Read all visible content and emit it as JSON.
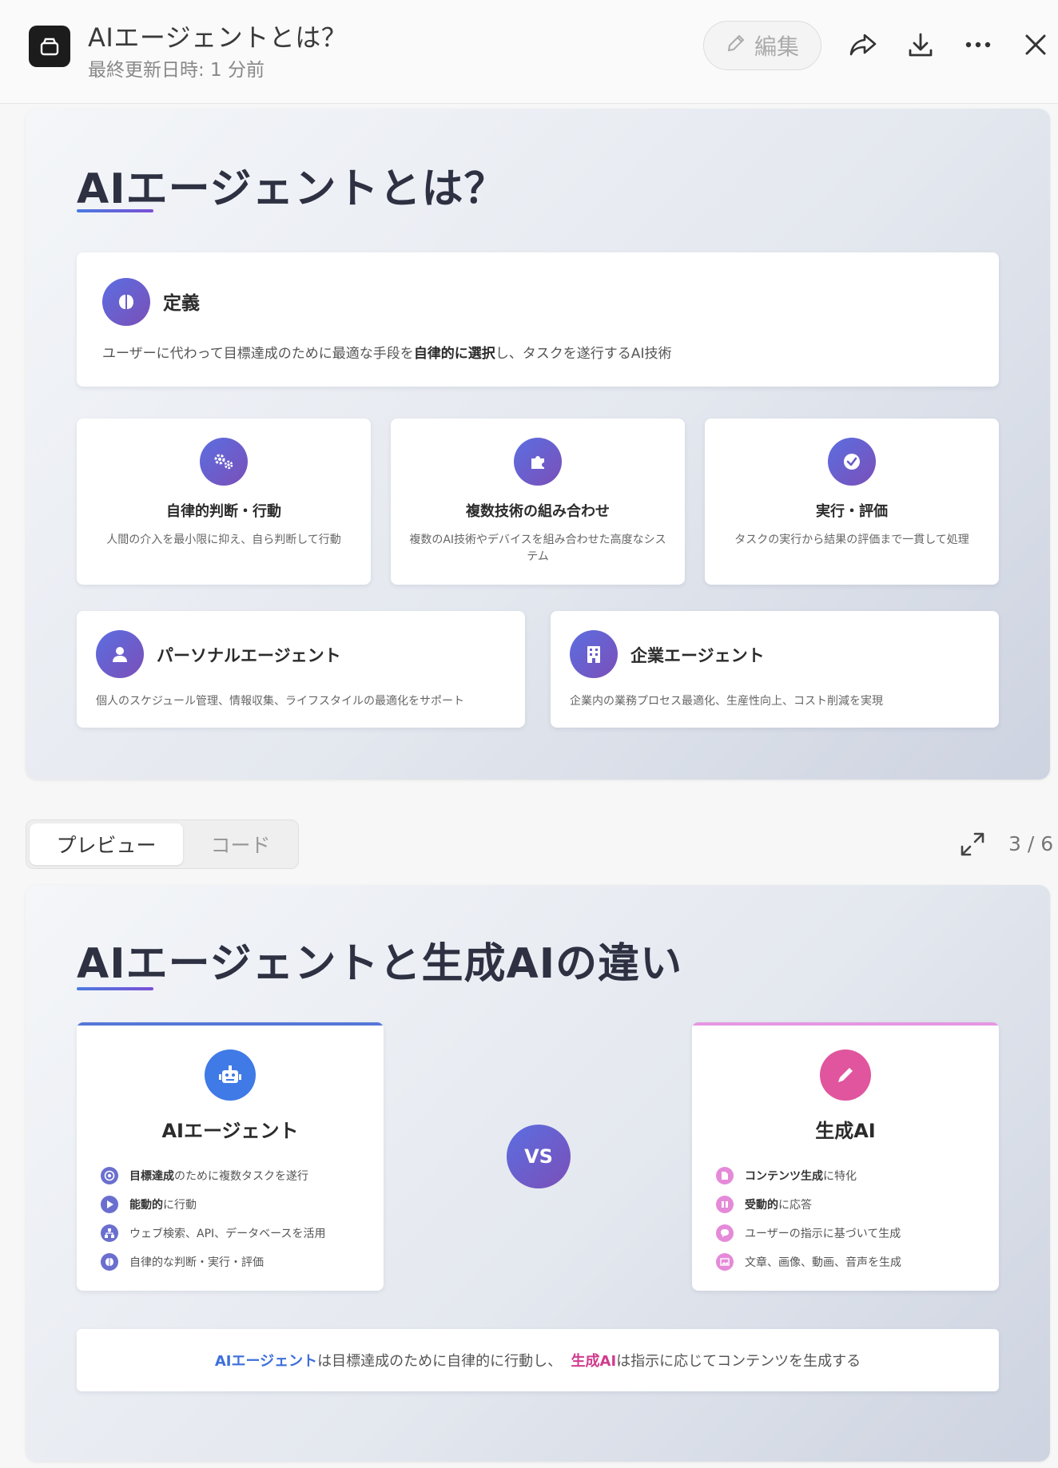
{
  "header": {
    "title": "AIエージェントとは？",
    "subtitle": "最終更新日時: 1 分前",
    "edit_label": "編集"
  },
  "slide1": {
    "title": "AIエージェントとは？",
    "definition": {
      "title": "定義",
      "text_before": "ユーザーに代わって目標達成のために最適な手段を",
      "text_bold": "自律的に選択",
      "text_after": "し、タスクを遂行するAI技術",
      "icon": "brain-icon"
    },
    "features": [
      {
        "title": "自律的判断・行動",
        "text": "人間の介入を最小限に抑え、自ら判断して行動",
        "icon": "gears-icon"
      },
      {
        "title": "複数技術の組み合わせ",
        "text": "複数のAI技術やデバイスを組み合わせた高度なシステム",
        "icon": "puzzle-icon"
      },
      {
        "title": "実行・評価",
        "text": "タスクの実行から結果の評価まで一貫して処理",
        "icon": "check-circle-icon"
      }
    ],
    "types": [
      {
        "title": "パーソナルエージェント",
        "text": "個人のスケジュール管理、情報収集、ライフスタイルの最適化をサポート",
        "icon": "user-icon"
      },
      {
        "title": "企業エージェント",
        "text": "企業内の業務プロセス最適化、生産性向上、コスト削減を実現",
        "icon": "building-icon"
      }
    ]
  },
  "tabs": {
    "preview": "プレビュー",
    "code": "コード",
    "page": "3 / 6"
  },
  "slide2": {
    "title": "AIエージェントと生成AIの違い",
    "agent": {
      "title": "AIエージェント",
      "accent": "#4a7be0",
      "items": [
        {
          "bold": "目標達成",
          "text": "のために複数タスクを遂行"
        },
        {
          "bold": "能動的",
          "text": "に行動"
        },
        {
          "bold": "",
          "text": "ウェブ検索、API、データベースを活用"
        },
        {
          "bold": "",
          "text": "自律的な判断・実行・評価"
        }
      ]
    },
    "vs": "VS",
    "genai": {
      "title": "生成AI",
      "accent": "#e0559e",
      "items": [
        {
          "bold": "コンテンツ生成",
          "text": "に特化"
        },
        {
          "bold": "受動的",
          "text": "に応答"
        },
        {
          "bold": "",
          "text": "ユーザーの指示に基づいて生成"
        },
        {
          "bold": "",
          "text": "文章、画像、動画、音声を生成"
        }
      ]
    },
    "summary": {
      "a": "AIエージェント",
      "mid": "は目標達成のために自律的に行動し、",
      "b": "生成AI",
      "end": "は指示に応じてコンテンツを生成する"
    }
  }
}
